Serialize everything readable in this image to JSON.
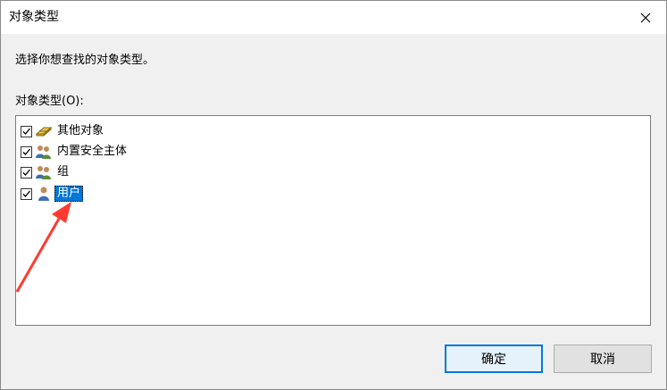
{
  "window": {
    "title": "对象类型"
  },
  "instruction": "选择你想查找的对象类型。",
  "list": {
    "label": "对象类型(O):",
    "items": [
      {
        "label": "其他对象",
        "icon": "other-objects-icon",
        "checked": true
      },
      {
        "label": "内置安全主体",
        "icon": "builtin-security-principal-icon",
        "checked": true
      },
      {
        "label": "组",
        "icon": "group-icon",
        "checked": true
      },
      {
        "label": "用户",
        "icon": "user-icon",
        "checked": true,
        "selected": true
      }
    ]
  },
  "buttons": {
    "ok": "确定",
    "cancel": "取消"
  },
  "colors": {
    "selection": "#0078d7",
    "annotation_arrow": "#ff3b30"
  }
}
